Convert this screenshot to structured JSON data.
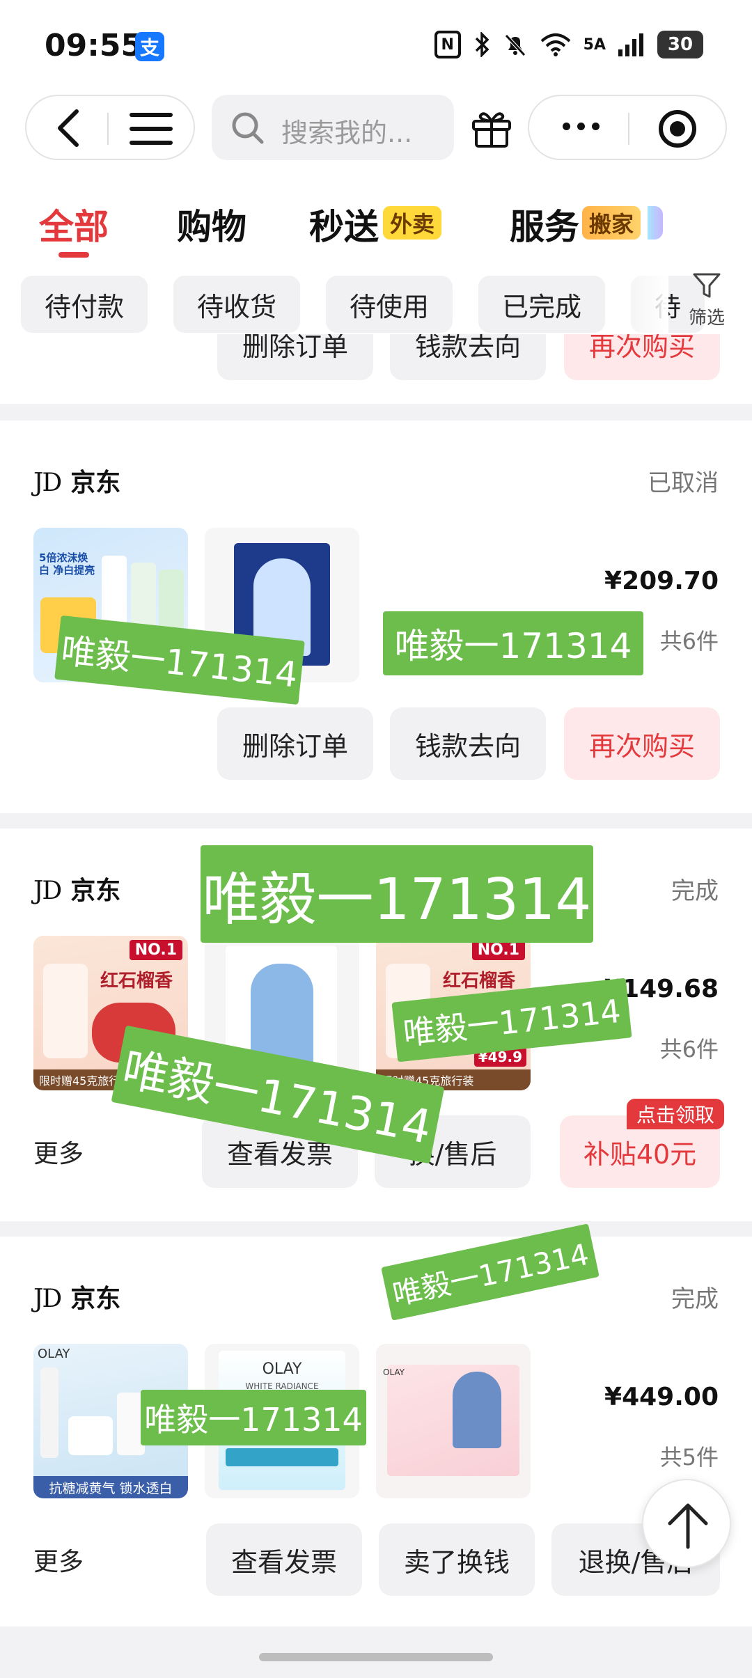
{
  "status_bar": {
    "time": "09:55",
    "alipay_glyph": "支",
    "network": "5A",
    "battery": "30"
  },
  "nav": {
    "search_placeholder": "搜索我的..."
  },
  "categories": [
    {
      "label": "全部",
      "badge": ""
    },
    {
      "label": "购物",
      "badge": ""
    },
    {
      "label": "秒送",
      "badge": "外卖"
    },
    {
      "label": "服务",
      "badge": "搬家"
    }
  ],
  "status_chips": [
    "待付款",
    "待收货",
    "待使用",
    "已完成",
    "待"
  ],
  "filter_label": "筛选",
  "orders": [
    {
      "store": "京东",
      "store_logo": "JD",
      "status": "已取消",
      "price": "¥209.70",
      "count": "共6件",
      "more": "",
      "buttons": [
        "删除订单",
        "钱款去向",
        "再次购买"
      ]
    },
    {
      "store": "京东",
      "store_logo": "JD",
      "status": "完成",
      "price": "¥149.68",
      "count": "共6件",
      "more": "更多",
      "buttons": [
        "查看发票",
        "换/售后",
        "补贴40元"
      ],
      "claim_tag": "点击领取"
    },
    {
      "store": "京东",
      "store_logo": "JD",
      "status": "完成",
      "price": "¥449.00",
      "count": "共5件",
      "more": "更多",
      "buttons": [
        "查看发票",
        "卖了换钱",
        "退换/售后"
      ]
    }
  ],
  "thumbs": {
    "colgate_badge": "5倍浓沫焕白 净白提亮",
    "safeguard_title": "红石榴香",
    "safeguard_tag": "NO.1",
    "safeguard_promo": "限时赠45克旅行装",
    "safeguard_price": "¥49.9",
    "olay_brand": "OLAY",
    "olay_caption": "抗糖减黄气 锁水透白",
    "olay_mask": "WHITE RADIANCE"
  },
  "watermark_text": "唯毅一171314",
  "colors": {
    "accent_red": "#e4393c",
    "watermark_green": "#6dbd4d",
    "tag_yellow": "#ffd83a"
  }
}
